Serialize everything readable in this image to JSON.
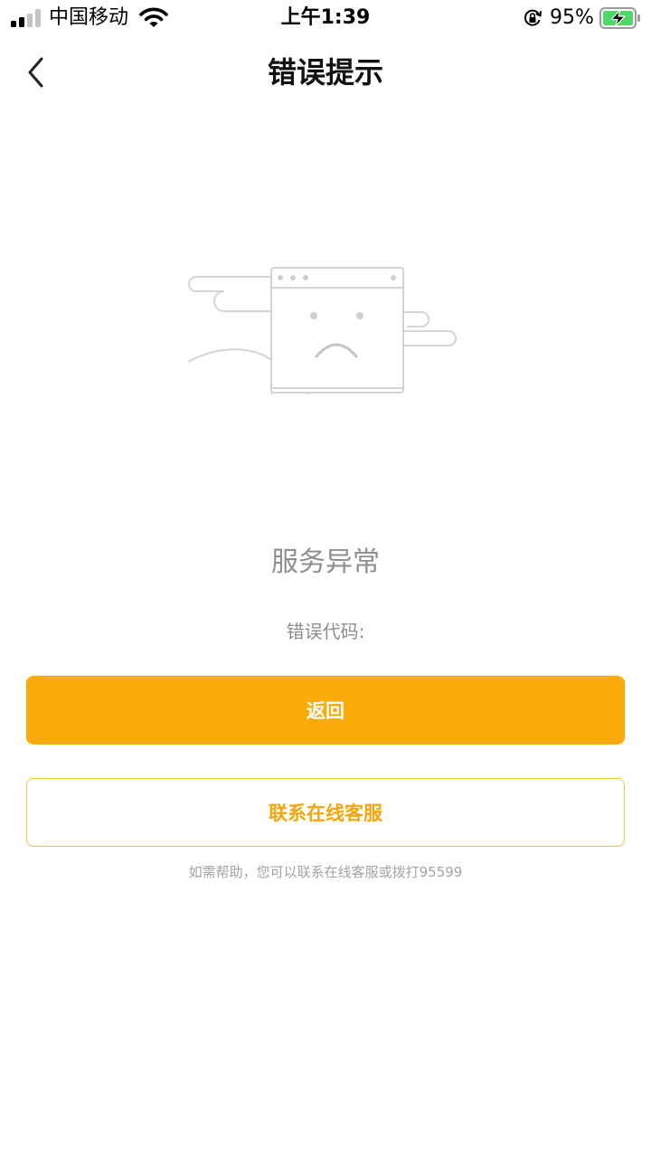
{
  "status_bar": {
    "carrier": "中国移动",
    "time": "上午1:39",
    "battery_percent": "95%",
    "icons": [
      "signal-icon",
      "wifi-icon",
      "orientation-lock-icon",
      "battery-charging-icon"
    ]
  },
  "nav": {
    "title": "错误提示",
    "back_icon": "chevron-left-icon"
  },
  "error": {
    "illustration": "sad-browser-window-illustration",
    "title": "服务异常",
    "code_label": "错误代码:"
  },
  "actions": {
    "back_label": "返回",
    "contact_label": "联系在线客服"
  },
  "help": {
    "text": "如需帮助，您可以联系在线客服或拨打95599"
  },
  "colors": {
    "accent": "#f9ab0a",
    "accent_text": "#f5a40b",
    "muted_text": "#8e8e8e",
    "battery_green": "#4cd964"
  }
}
